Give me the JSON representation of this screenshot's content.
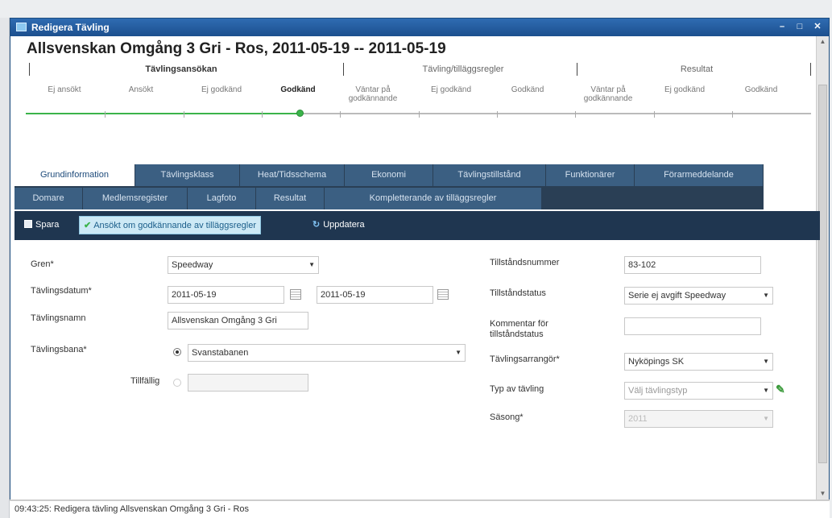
{
  "window": {
    "title": "Redigera Tävling"
  },
  "heading": "Allsvenskan Omgång 3 Gri - Ros, 2011-05-19 -- 2011-05-19",
  "progress": {
    "stages": [
      "Tävlingsansökan",
      "Tävling/tilläggsregler",
      "Resultat"
    ],
    "steps": [
      {
        "label": "Ej ansökt"
      },
      {
        "label": "Ansökt"
      },
      {
        "label": "Ej godkänd"
      },
      {
        "label": "Godkänd"
      },
      {
        "label": "Väntar på godkännande"
      },
      {
        "label": "Ej godkänd"
      },
      {
        "label": "Godkänd"
      },
      {
        "label": "Väntar på godkännande"
      },
      {
        "label": "Ej godkänd"
      },
      {
        "label": "Godkänd"
      }
    ],
    "current_step": "Godkänd",
    "colors": {
      "done": "#3bb34a",
      "pending": "#bbbbbb"
    }
  },
  "tabs": {
    "row1": [
      "Grundinformation",
      "Tävlingsklass",
      "Heat/Tidsschema",
      "Ekonomi",
      "Tävlingstillstånd",
      "Funktionärer",
      "Förarmeddelande"
    ],
    "row2": [
      "Domare",
      "Medlemsregister",
      "Lagfoto",
      "Resultat",
      "Kompletterande av tilläggsregler"
    ],
    "active": "Grundinformation",
    "colors": {
      "active_bg": "#ffffff",
      "tab_bg": "#3b5f82",
      "tabstrip_bg": "#2a3f55"
    }
  },
  "toolbar": {
    "save": "Spara",
    "apply": "Ansökt om godkännande av tilläggsregler",
    "refresh": "Uppdatera",
    "colors": {
      "bg": "#1f3650",
      "highlight_bg": "#cde9f5"
    }
  },
  "form": {
    "gren_label": "Gren*",
    "gren_value": "Speedway",
    "datum_label": "Tävlingsdatum*",
    "datum_from": "2011-05-19",
    "datum_to": "2011-05-19",
    "namn_label": "Tävlingsnamn",
    "namn_value": "Allsvenskan Omgång 3 Gri",
    "bana_label": "Tävlingsbana*",
    "bana_value": "Svanstabanen",
    "tillfallig_label": "Tillfällig",
    "tillfallig_value": "",
    "tillstandsnummer_label": "Tillståndsnummer",
    "tillstandsnummer_value": "83-102",
    "tillstandsstatus_label": "Tillståndstatus",
    "tillstandsstatus_value": "Serie ej avgift Speedway",
    "kommentar_label": "Kommentar för tillståndstatus",
    "kommentar_value": "",
    "arrangor_label": "Tävlingsarrangör*",
    "arrangor_value": "Nyköpings SK",
    "typ_label": "Typ av tävling",
    "typ_value": "Välj tävlingstyp",
    "sasong_label": "Säsong*",
    "sasong_value": "2011"
  },
  "statusbar": {
    "text": "09:43:25: Redigera tävling Allsvenskan Omgång 3 Gri - Ros"
  },
  "icons": {
    "save": "save-icon",
    "apply": "check-icon",
    "refresh": "refresh-icon",
    "calendar": "calendar-icon",
    "edit": "edit-pen-icon"
  }
}
